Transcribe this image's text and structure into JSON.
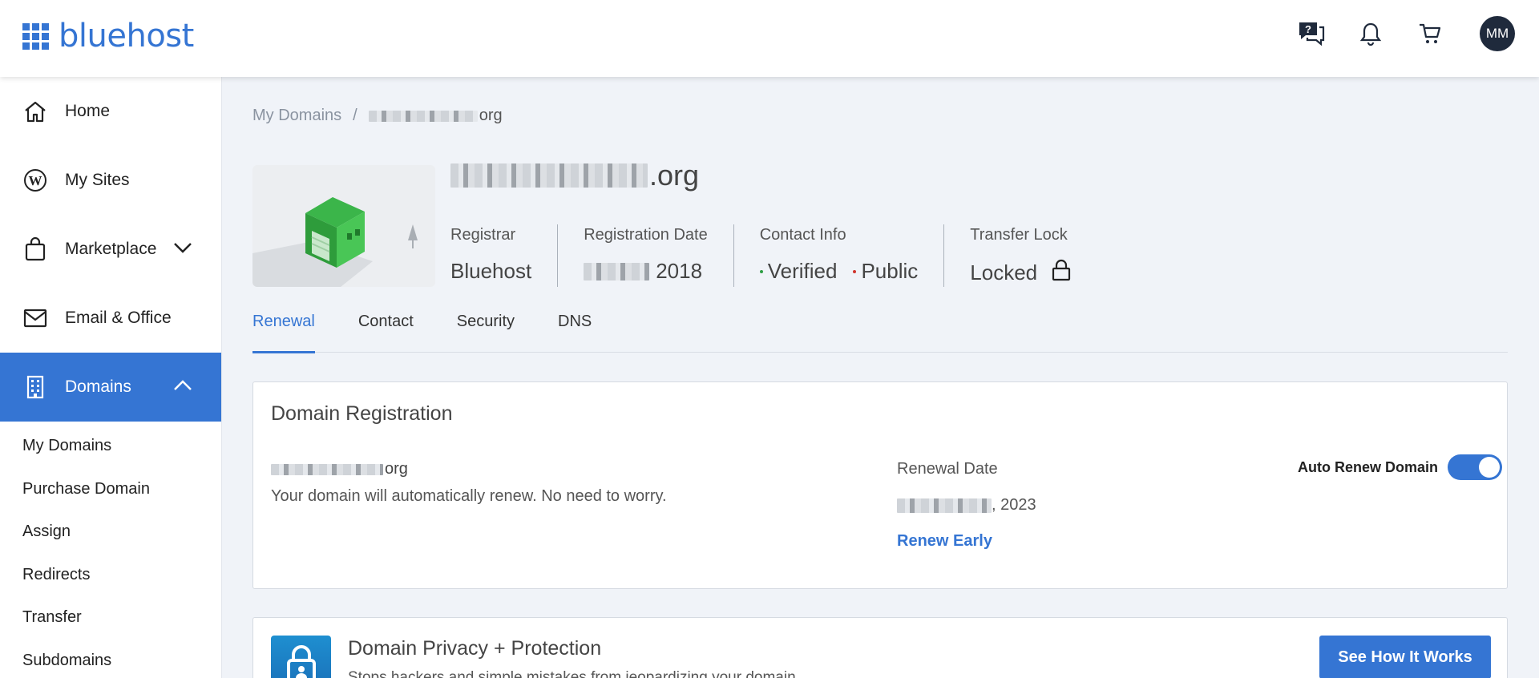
{
  "header": {
    "logo_text": "bluehost",
    "icons": [
      "chat-help-icon",
      "bell-icon",
      "cart-icon"
    ],
    "avatar_initials": "MM"
  },
  "sidebar": {
    "items": [
      {
        "label": "Home",
        "icon": "home-icon"
      },
      {
        "label": "My Sites",
        "icon": "wordpress-icon"
      },
      {
        "label": "Marketplace",
        "icon": "shopping-bag-icon"
      },
      {
        "label": "Email & Office",
        "icon": "envelope-icon"
      },
      {
        "label": "Domains",
        "icon": "building-icon"
      }
    ],
    "sub_items": [
      "My Domains",
      "Purchase Domain",
      "Assign",
      "Redirects",
      "Transfer",
      "Subdomains"
    ]
  },
  "breadcrumb": {
    "root": "My Domains",
    "separator": "/",
    "current_suffix": "org"
  },
  "domain": {
    "name_suffix": ".org",
    "registrar_label": "Registrar",
    "registrar_value": "Bluehost",
    "registration_date_label": "Registration Date",
    "registration_year": "2018",
    "contact_label": "Contact Info",
    "contact_verified": "Verified",
    "contact_public": "Public",
    "transfer_lock_label": "Transfer Lock",
    "transfer_lock_value": "Locked"
  },
  "tabs": [
    "Renewal",
    "Contact",
    "Security",
    "DNS"
  ],
  "registration_card": {
    "title": "Domain Registration",
    "domain_suffix": "org",
    "description": "Your domain will automatically renew. No need to worry.",
    "renewal_date_label": "Renewal Date",
    "renewal_year": ", 2023",
    "renew_early": "Renew Early",
    "auto_renew_label": "Auto Renew Domain"
  },
  "privacy_card": {
    "title": "Domain Privacy + Protection",
    "description": "Stops hackers and simple mistakes from jeopardizing your domain.",
    "button": "See How It Works"
  },
  "colors": {
    "brand": "#3575d3",
    "verified_dot": "#2e9e44",
    "public_dot": "#d0342c"
  }
}
